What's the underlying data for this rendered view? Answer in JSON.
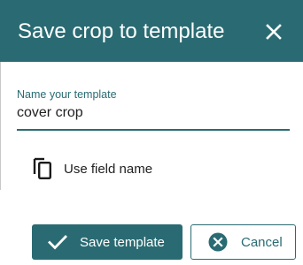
{
  "dialog": {
    "title": "Save crop to template",
    "close_icon": "close-icon"
  },
  "form": {
    "template_name": {
      "label": "Name your template",
      "value": "cover crop"
    },
    "use_field_name": {
      "label": "Use field name",
      "icon": "copy-icon"
    }
  },
  "actions": {
    "save": {
      "label": "Save template",
      "icon": "check-icon"
    },
    "cancel": {
      "label": "Cancel",
      "icon": "cancel-circle-icon"
    }
  },
  "colors": {
    "accent": "#2a6b73",
    "text": "#212121",
    "background": "#ffffff"
  }
}
